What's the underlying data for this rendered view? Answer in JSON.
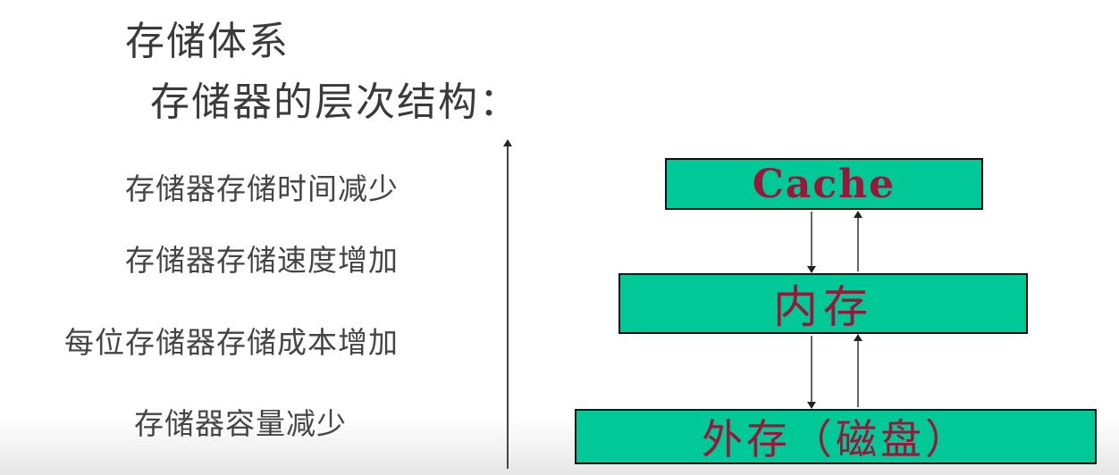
{
  "header": {
    "title": "存储体系",
    "subtitle": "存储器的层次结构："
  },
  "axis_labels": [
    "存储器存储时间减少",
    "存储器存储速度增加",
    "每位存储器存储成本增加",
    "存储器容量减少"
  ],
  "hierarchy": {
    "cache": "Cache",
    "memory": "内存",
    "disk": "外存（磁盘）"
  },
  "colors": {
    "box_fill": "#00c896",
    "box_text": "#9b1638"
  }
}
